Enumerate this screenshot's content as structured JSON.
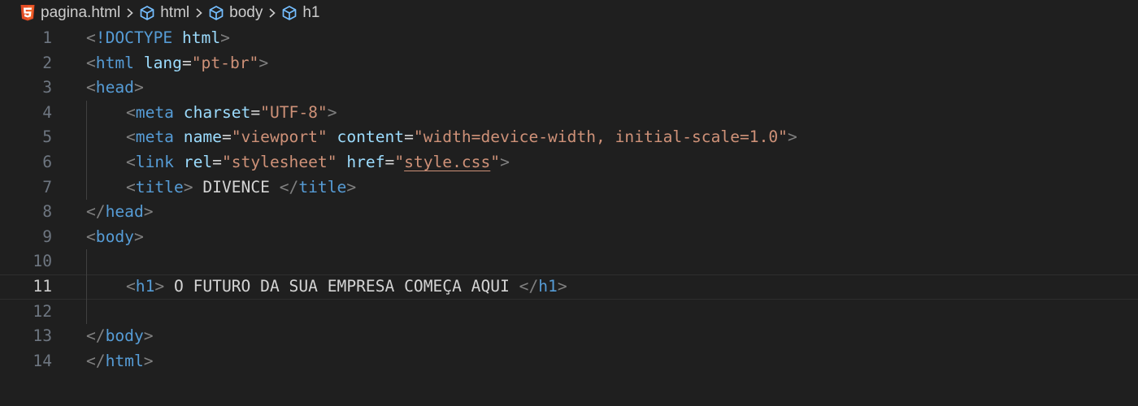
{
  "breadcrumb": {
    "file": "pagina.html",
    "items": [
      "html",
      "body",
      "h1"
    ]
  },
  "editor": {
    "current_line": 11,
    "lines": [
      {
        "n": 1,
        "indent": 0,
        "tokens": [
          [
            "br",
            "<"
          ],
          [
            "tag",
            "!DOCTYPE"
          ],
          [
            "txt",
            " "
          ],
          [
            "attr",
            "html"
          ],
          [
            "br",
            ">"
          ]
        ]
      },
      {
        "n": 2,
        "indent": 0,
        "tokens": [
          [
            "br",
            "<"
          ],
          [
            "tag",
            "html"
          ],
          [
            "txt",
            " "
          ],
          [
            "attr",
            "lang"
          ],
          [
            "txt",
            "="
          ],
          [
            "str",
            "\"pt-br\""
          ],
          [
            "br",
            ">"
          ]
        ]
      },
      {
        "n": 3,
        "indent": 0,
        "tokens": [
          [
            "br",
            "<"
          ],
          [
            "tag",
            "head"
          ],
          [
            "br",
            ">"
          ]
        ]
      },
      {
        "n": 4,
        "indent": 1,
        "tokens": [
          [
            "br",
            "<"
          ],
          [
            "tag",
            "meta"
          ],
          [
            "txt",
            " "
          ],
          [
            "attr",
            "charset"
          ],
          [
            "txt",
            "="
          ],
          [
            "str",
            "\"UTF-8\""
          ],
          [
            "br",
            ">"
          ]
        ]
      },
      {
        "n": 5,
        "indent": 1,
        "tokens": [
          [
            "br",
            "<"
          ],
          [
            "tag",
            "meta"
          ],
          [
            "txt",
            " "
          ],
          [
            "attr",
            "name"
          ],
          [
            "txt",
            "="
          ],
          [
            "str",
            "\"viewport\""
          ],
          [
            "txt",
            " "
          ],
          [
            "attr",
            "content"
          ],
          [
            "txt",
            "="
          ],
          [
            "str",
            "\"width=device-width, initial-scale=1.0\""
          ],
          [
            "br",
            ">"
          ]
        ]
      },
      {
        "n": 6,
        "indent": 1,
        "tokens": [
          [
            "br",
            "<"
          ],
          [
            "tag",
            "link"
          ],
          [
            "txt",
            " "
          ],
          [
            "attr",
            "rel"
          ],
          [
            "txt",
            "="
          ],
          [
            "str",
            "\"stylesheet\""
          ],
          [
            "txt",
            " "
          ],
          [
            "attr",
            "href"
          ],
          [
            "txt",
            "="
          ],
          [
            "str",
            "\""
          ],
          [
            "link",
            "style.css"
          ],
          [
            "str",
            "\""
          ],
          [
            "br",
            ">"
          ]
        ]
      },
      {
        "n": 7,
        "indent": 1,
        "tokens": [
          [
            "br",
            "<"
          ],
          [
            "tag",
            "title"
          ],
          [
            "br",
            ">"
          ],
          [
            "txt",
            " DIVENCE "
          ],
          [
            "br",
            "</"
          ],
          [
            "tag",
            "title"
          ],
          [
            "br",
            ">"
          ]
        ]
      },
      {
        "n": 8,
        "indent": 0,
        "tokens": [
          [
            "br",
            "</"
          ],
          [
            "tag",
            "head"
          ],
          [
            "br",
            ">"
          ]
        ]
      },
      {
        "n": 9,
        "indent": 0,
        "tokens": [
          [
            "br",
            "<"
          ],
          [
            "tag",
            "body"
          ],
          [
            "br",
            ">"
          ]
        ]
      },
      {
        "n": 10,
        "indent": 0,
        "tokens": []
      },
      {
        "n": 11,
        "indent": 1,
        "tokens": [
          [
            "br",
            "<"
          ],
          [
            "tag",
            "h1"
          ],
          [
            "br",
            ">"
          ],
          [
            "txt",
            " O FUTURO DA SUA EMPRESA COMEÇA AQUI "
          ],
          [
            "br",
            "</"
          ],
          [
            "tag",
            "h1"
          ],
          [
            "br",
            ">"
          ]
        ]
      },
      {
        "n": 12,
        "indent": 0,
        "tokens": []
      },
      {
        "n": 13,
        "indent": 0,
        "tokens": [
          [
            "br",
            "</"
          ],
          [
            "tag",
            "body"
          ],
          [
            "br",
            ">"
          ]
        ]
      },
      {
        "n": 14,
        "indent": 0,
        "tokens": [
          [
            "br",
            "</"
          ],
          [
            "tag",
            "html"
          ],
          [
            "br",
            ">"
          ]
        ]
      }
    ]
  },
  "icons": {
    "file": "html5-icon",
    "element": "symbol-element-icon",
    "separator": "chevron-right-icon"
  },
  "colors": {
    "background": "#1f1f1f",
    "tag": "#569cd6",
    "bracket": "#808080",
    "attribute": "#9cdcfe",
    "string": "#ce9178",
    "text": "#d4d4d4",
    "line_number": "#6e7681",
    "html5_icon": "#e44d26",
    "symbol_icon": "#75beff"
  }
}
